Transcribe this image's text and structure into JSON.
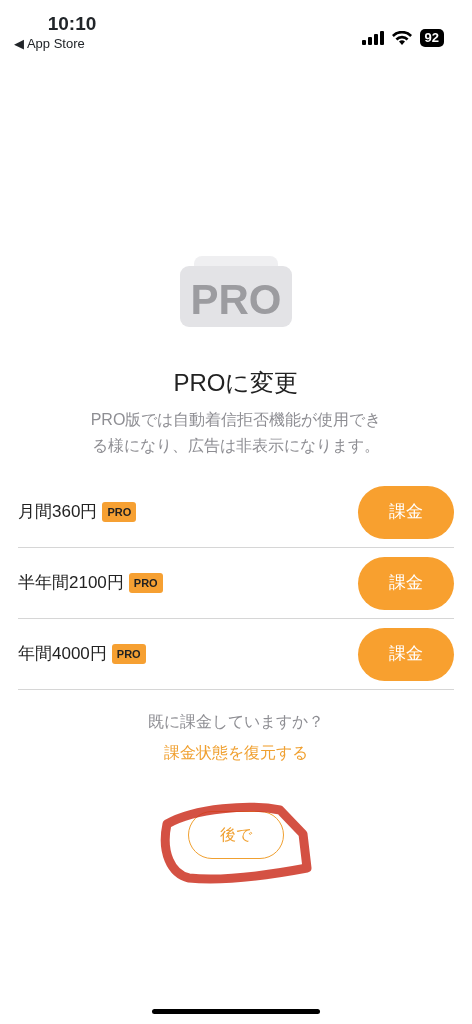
{
  "status_bar": {
    "time": "10:10",
    "back_link": "◀ App Store",
    "battery": "92"
  },
  "header": {
    "icon_text": "PRO",
    "title": "PROに変更",
    "description": "PRO版では自動着信拒否機能が使用できる様になり、広告は非表示になります。"
  },
  "plans": [
    {
      "name": "月間360円",
      "badge": "PRO",
      "button": "課金"
    },
    {
      "name": "半年間2100円",
      "badge": "PRO",
      "button": "課金"
    },
    {
      "name": "年間4000円",
      "badge": "PRO",
      "button": "課金"
    }
  ],
  "restore": {
    "question": "既に課金していますか？",
    "link": "課金状態を復元する"
  },
  "later_button": "後で"
}
